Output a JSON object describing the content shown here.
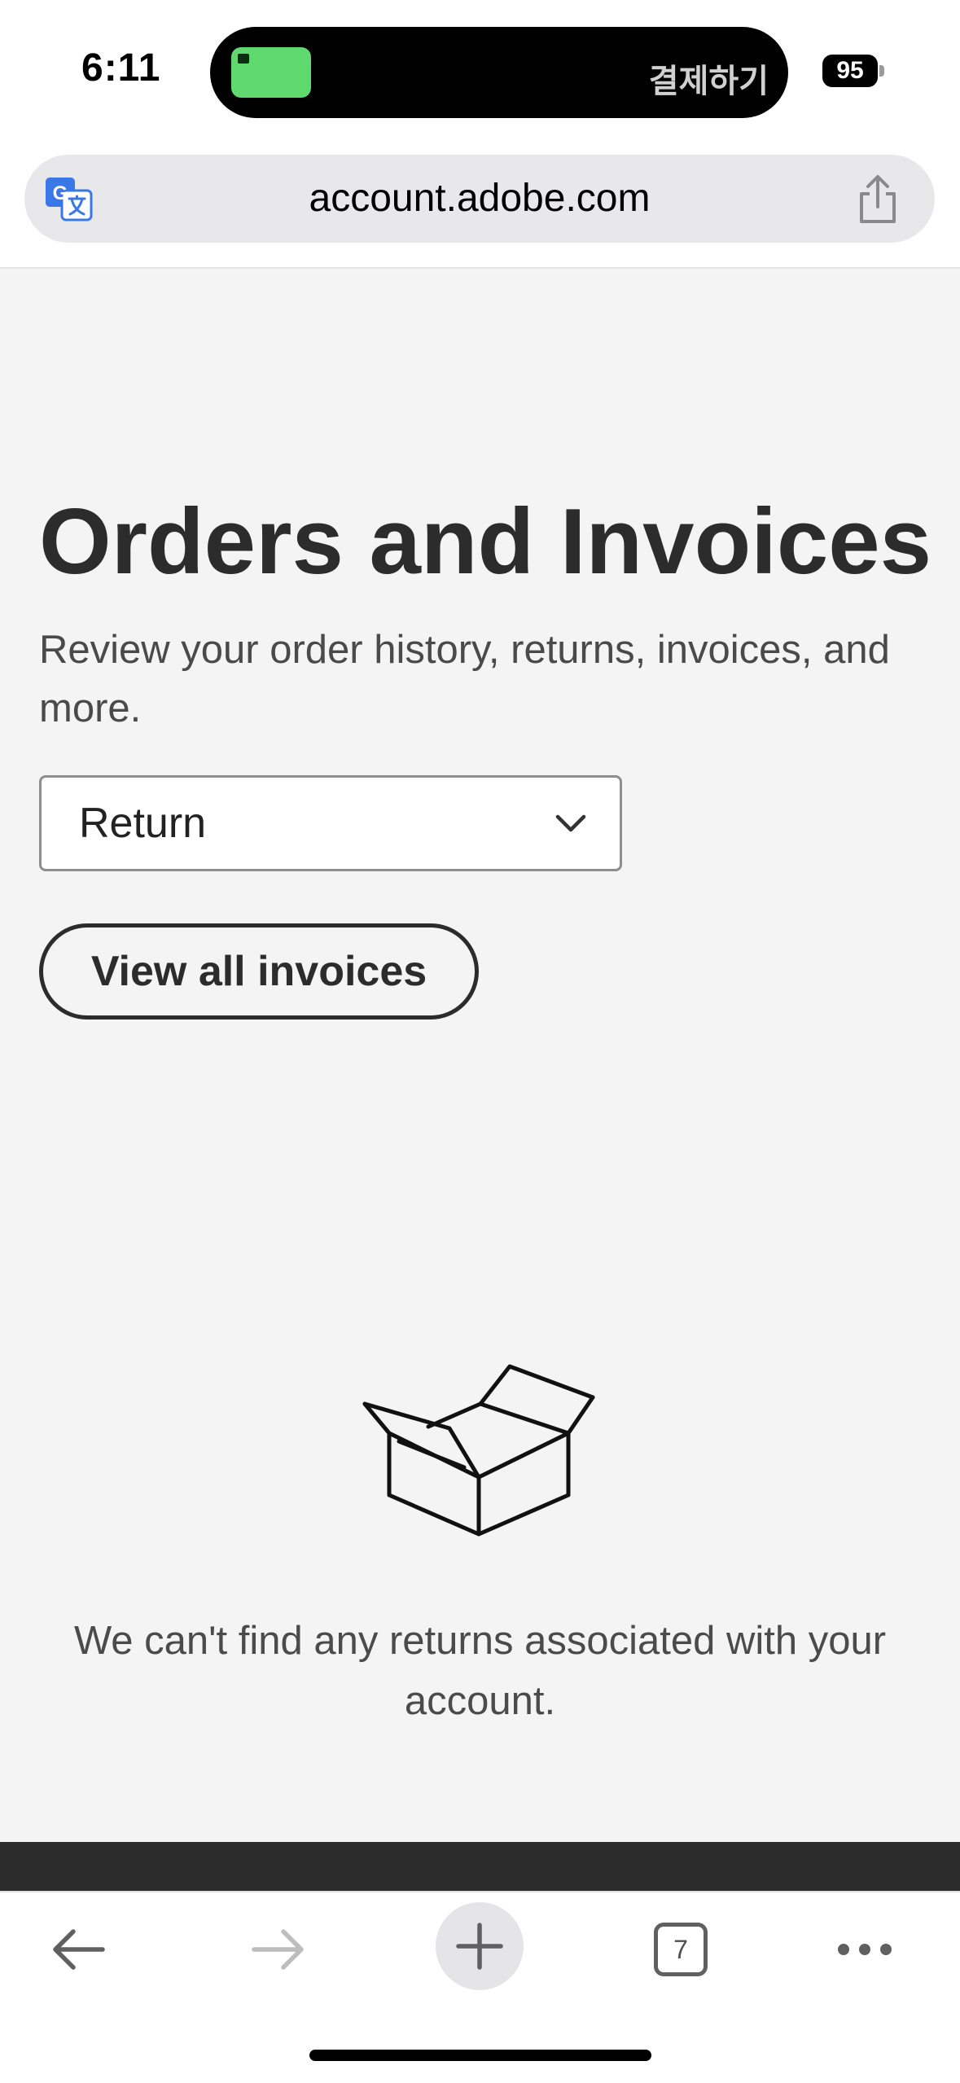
{
  "status_bar": {
    "time": "6:11",
    "island_text": "결제하기",
    "battery": "95"
  },
  "browser": {
    "url": "account.adobe.com",
    "tabs_count": "7"
  },
  "page": {
    "title": "Orders and Invoices",
    "subtitle": "Review your order history, returns, invoices, and more.",
    "filter_select": {
      "selected": "Return"
    },
    "view_invoices_label": "View all invoices",
    "empty_message": "We can't find any returns associated with your account."
  },
  "icons": {
    "translate": "translate-icon",
    "share": "share-icon",
    "chevron": "chevron-down-icon",
    "box": "empty-box-icon",
    "back": "back-arrow-icon",
    "forward": "forward-arrow-icon",
    "new_tab": "plus-icon",
    "more": "more-dots-icon"
  },
  "colors": {
    "page_background": "#f4f4f4",
    "title_text": "#2c2c2c",
    "footer_band": "#2c2c2c",
    "island_app": "#5fd86d",
    "translate_blue": "#3b78e7"
  }
}
